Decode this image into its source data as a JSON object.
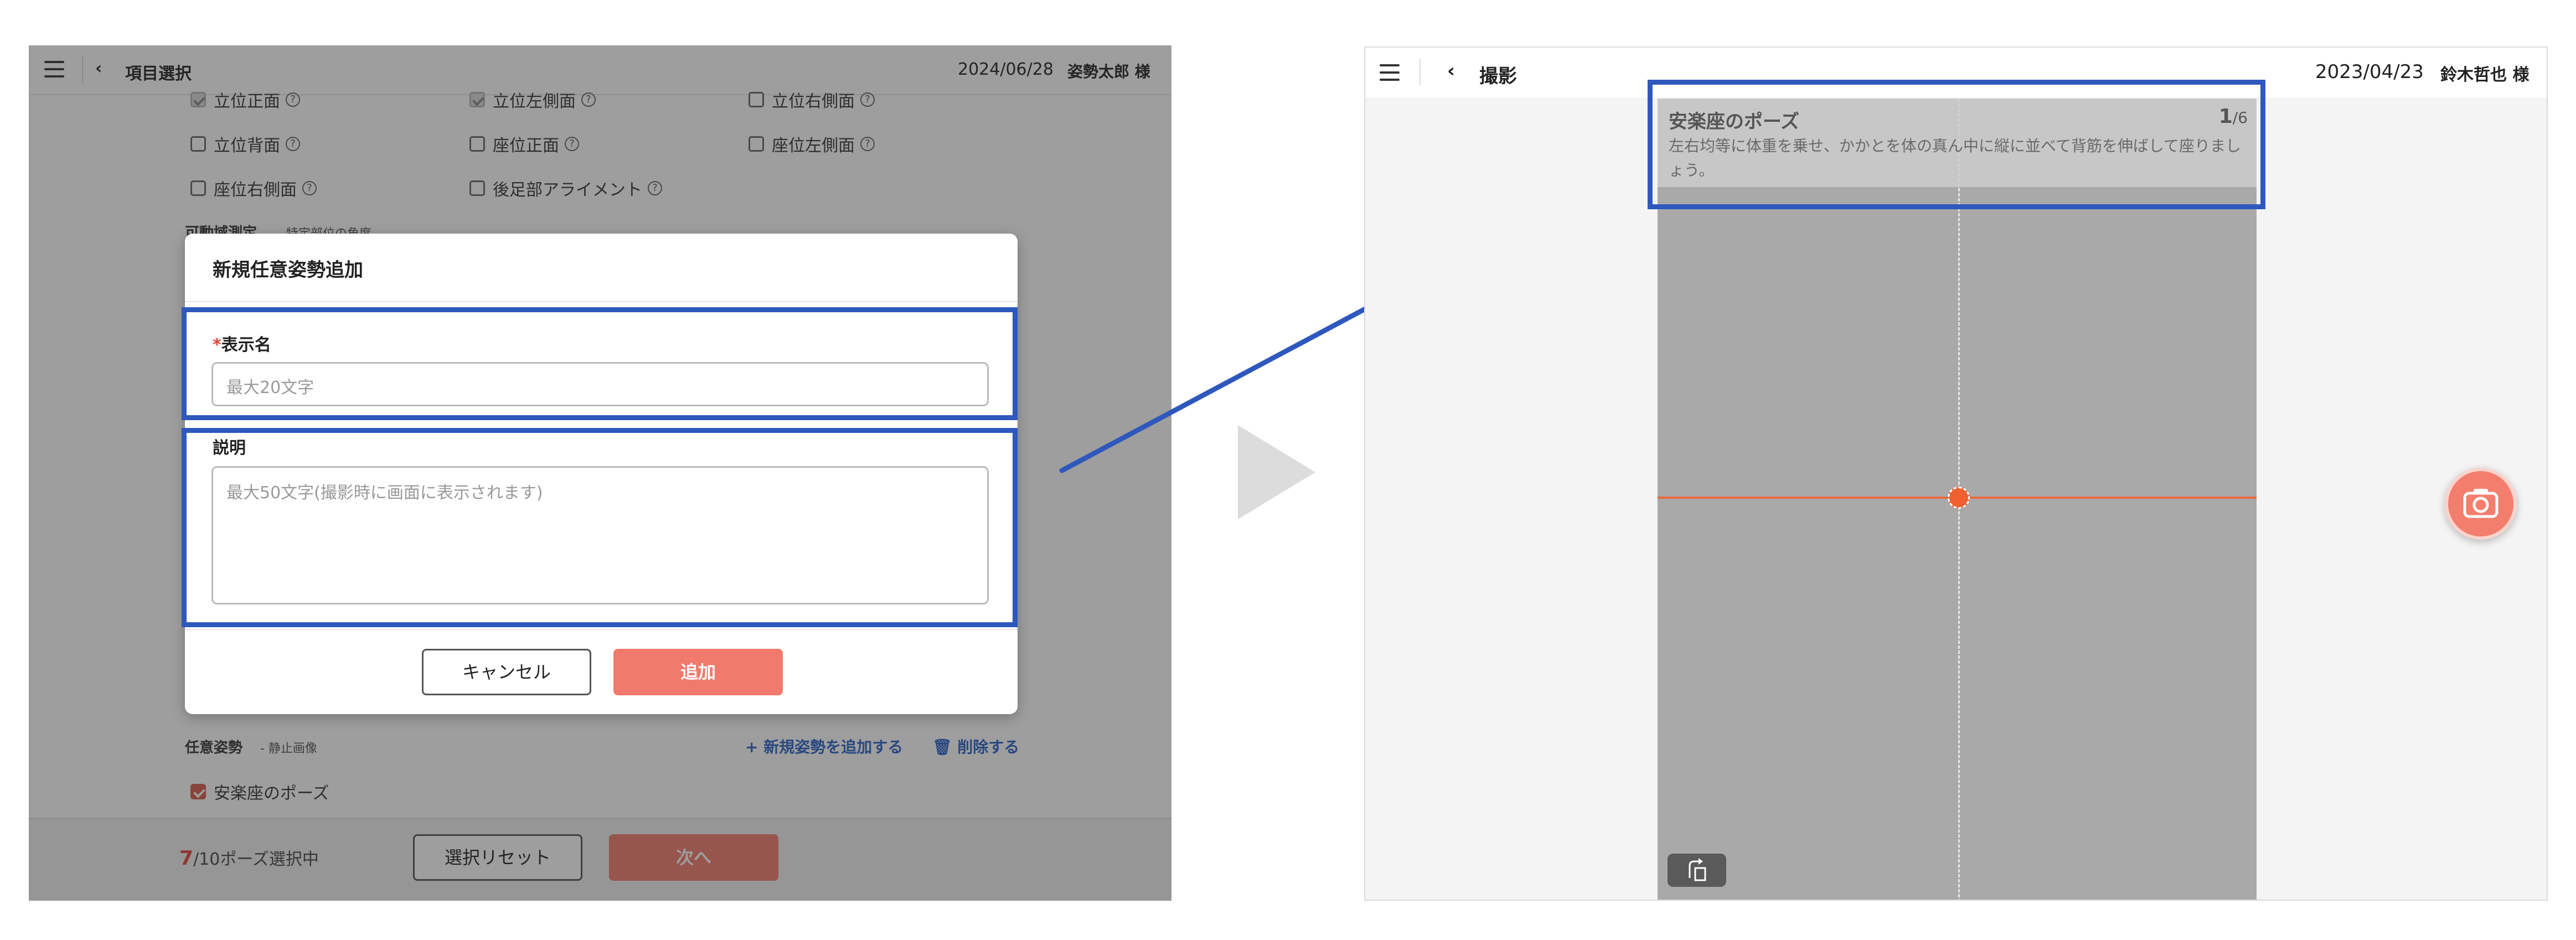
{
  "left_screen": {
    "header": {
      "back": "‹",
      "title": "項目選択",
      "date": "2024/06/28",
      "user": "姿勢太郎 様"
    },
    "checkboxes": [
      {
        "label": "立位正面",
        "state": "disabled-checked"
      },
      {
        "label": "立位左側面",
        "state": "disabled-checked"
      },
      {
        "label": "立位右側面",
        "state": "unchecked"
      },
      {
        "label": "立位背面",
        "state": "unchecked"
      },
      {
        "label": "座位正面",
        "state": "unchecked"
      },
      {
        "label": "座位左側面",
        "state": "unchecked"
      },
      {
        "label": "座位右側面",
        "state": "unchecked"
      },
      {
        "label": "後足部アライメント",
        "state": "unchecked"
      }
    ],
    "help_glyph": "?",
    "range_section_label": "可動域測定",
    "range_section_note": "- 特定部位の角度",
    "arbitrary_label": "任意姿勢",
    "arbitrary_note": "- 静止画像",
    "add_new_link": "+ 新規姿勢を追加する",
    "delete_link": "🗑 削除する",
    "arbitrary_item": "安楽座のポーズ",
    "footer": {
      "count": "7",
      "count_suffix": "/10ポーズ選択中",
      "reset_label": "選択リセット",
      "next_label": "次へ"
    },
    "modal": {
      "title": "新規任意姿勢追加",
      "required_mark": "*",
      "name_label": "表示名",
      "name_placeholder": "最大20文字",
      "desc_label": "説明",
      "desc_placeholder": "最大50文字(撮影時に画面に表示されます)",
      "cancel_label": "キャンセル",
      "add_label": "追加"
    }
  },
  "right_screen": {
    "header": {
      "back": "‹",
      "title": "撮影",
      "date": "2023/04/23",
      "user": "鈴木哲也 様"
    },
    "pose_card": {
      "title": "安楽座のポーズ",
      "current": "1",
      "total": "/6",
      "description": "左右均等に体重を乗せ、かかとを体の真ん中に縦に並べて背筋を伸ばして座りましょう。"
    }
  },
  "colors": {
    "highlight": "#2f58bd",
    "accent_red": "#f07a6c",
    "guide_line": "#e96a3c"
  },
  "icons": [
    "menu-icon",
    "back-chevron-icon",
    "help-icon",
    "camera-icon",
    "rotate-icon",
    "play-arrow-icon",
    "trash-icon"
  ]
}
